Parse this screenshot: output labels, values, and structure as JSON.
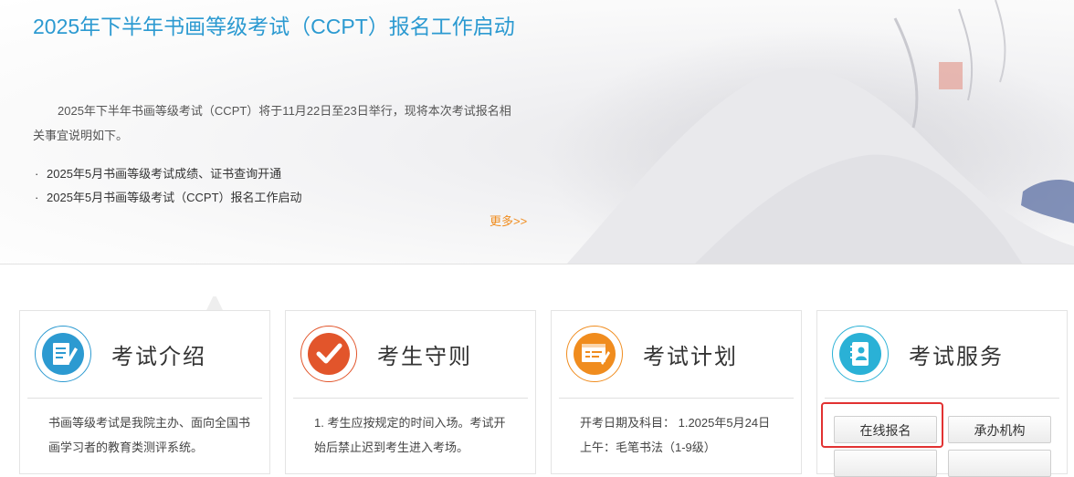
{
  "news": {
    "title": "2025年下半年书画等级考试（CCPT）报名工作启动",
    "summary": "2025年下半年书画等级考试（CCPT）将于11月22日至23日举行，现将本次考试报名相关事宜说明如下。",
    "items": [
      {
        "bullet": "·",
        "text": "2025年5月书画等级考试成绩、证书查询开通"
      },
      {
        "bullet": "·",
        "text": "2025年5月书画等级考试（CCPT）报名工作启动"
      }
    ],
    "more_label": "更多>>"
  },
  "cards": [
    {
      "title": "考试介绍",
      "icon": "document-edit-icon",
      "color": "#2c9ad1",
      "text": "书画等级考试是我院主办、面向全国书画学习者的教育类测评系统。"
    },
    {
      "title": "考生守则",
      "icon": "checkmark-icon",
      "color": "#e2552b",
      "text": "1. 考生应按规定的时间入场。考试开始后禁止迟到考生进入考场。"
    },
    {
      "title": "考试计划",
      "icon": "schedule-board-icon",
      "color": "#f08c1e",
      "text": "开考日期及科目： 1.2025年5月24日 上午：毛笔书法（1-9级）"
    },
    {
      "title": "考试服务",
      "icon": "contact-book-icon",
      "color": "#2ab1d6",
      "buttons": [
        "在线报名",
        "承办机构",
        "",
        ""
      ]
    }
  ],
  "colors": {
    "title_blue": "#2c9ad1",
    "more_orange": "#f08c1e",
    "highlight_red": "#e23232"
  }
}
